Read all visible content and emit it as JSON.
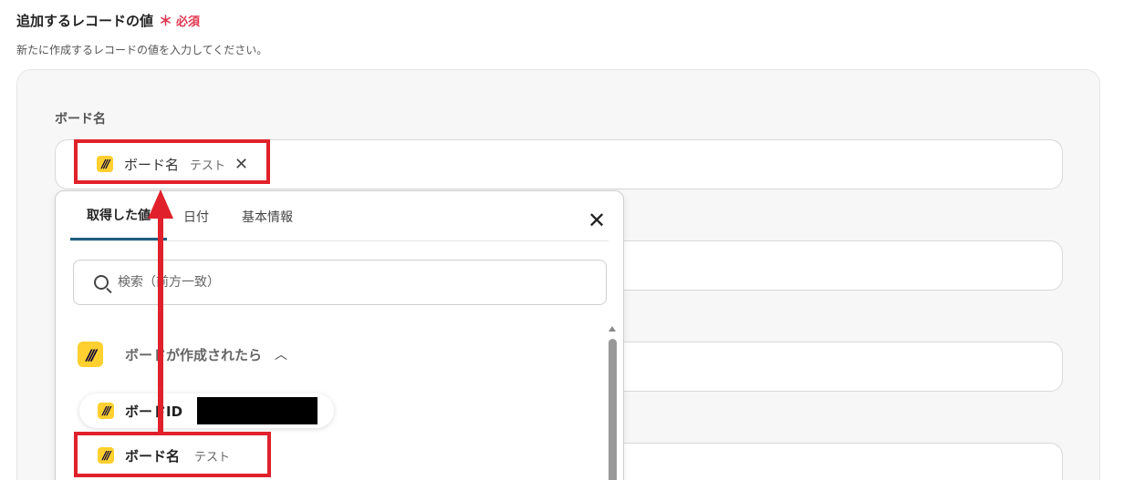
{
  "section": {
    "title": "追加するレコードの値",
    "required_star": "＊",
    "required_text": "必須",
    "description": "新たに作成するレコードの値を入力してください。"
  },
  "field": {
    "label": "ボード名",
    "selected_chip": {
      "label": "ボード名",
      "value": "テスト"
    }
  },
  "dropdown": {
    "tabs": [
      {
        "label": "取得した値",
        "active": true
      },
      {
        "label": "日付",
        "active": false
      },
      {
        "label": "基本情報",
        "active": false
      }
    ],
    "search_placeholder": "検索（前方一致）",
    "group": {
      "label": "ボードが作成されたら",
      "icon": "miro-icon"
    },
    "items": [
      {
        "label": "ボードID",
        "value": ""
      },
      {
        "label": "ボード名",
        "value": "テスト"
      }
    ]
  },
  "colors": {
    "highlight": "#e0212b",
    "required": "#e0364f",
    "tab_active": "#1f5f80",
    "miro_yellow": "#ffd02f"
  }
}
